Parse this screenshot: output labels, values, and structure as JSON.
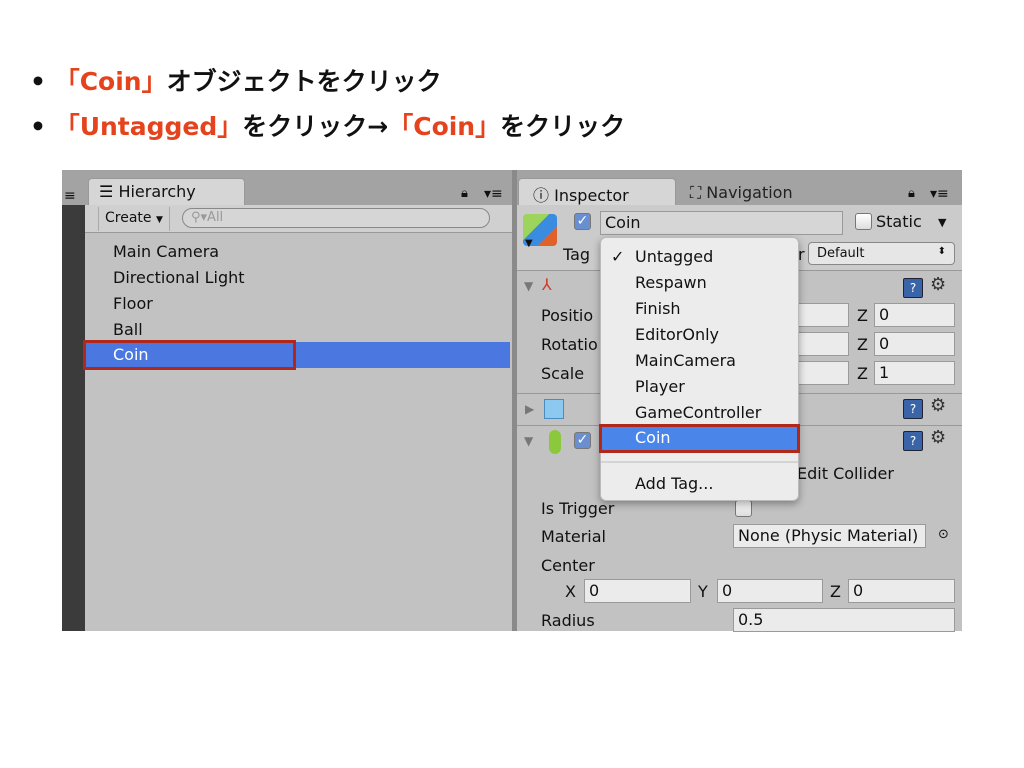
{
  "instructions": [
    {
      "bullet": "•",
      "parts": [
        {
          "text": "「Coin」",
          "red": true
        },
        {
          "text": "オブジェクトをクリック",
          "red": false
        }
      ]
    },
    {
      "bullet": "•",
      "parts": [
        {
          "text": "「Untagged」",
          "red": true
        },
        {
          "text": "をクリック→",
          "red": false
        },
        {
          "text": "「Coin」",
          "red": true
        },
        {
          "text": "をクリック",
          "red": false
        }
      ]
    }
  ],
  "colors": {
    "accent_red": "#e5431d",
    "selection_blue": "#4a78e0",
    "highlight_box": "#b0281c"
  },
  "hierarchy": {
    "tab_label": "Hierarchy",
    "create_label": "Create",
    "search_placeholder": "All",
    "items": [
      "Main Camera",
      "Directional Light",
      "Floor",
      "Ball",
      "Coin"
    ],
    "selected": "Coin"
  },
  "inspector": {
    "tab_label": "Inspector",
    "nav_tab_label": "Navigation",
    "object_name": "Coin",
    "static_label": "Static",
    "tag_label": "Tag",
    "layer_label_fragment": "r",
    "layer_value": "Default",
    "transform": {
      "rows": [
        {
          "label": "Positio",
          "z_label": "Z",
          "z": "0"
        },
        {
          "label": "Rotatio",
          "z_label": "Z",
          "z": "0"
        },
        {
          "label": "Scale",
          "z_label": "Z",
          "z": "1"
        }
      ]
    },
    "collider": {
      "edit_collider": "Edit Collider",
      "is_trigger_label": "Is Trigger",
      "material_label": "Material",
      "material_value": "None (Physic Material)",
      "center_label": "Center",
      "center": [
        {
          "axis": "X",
          "value": "0"
        },
        {
          "axis": "Y",
          "value": "0"
        },
        {
          "axis": "Z",
          "value": "0"
        }
      ],
      "radius_label": "Radius",
      "radius_value": "0.5"
    }
  },
  "tag_menu": {
    "checkmark": "✓",
    "items": [
      "Untagged",
      "Respawn",
      "Finish",
      "EditorOnly",
      "MainCamera",
      "Player",
      "GameController",
      "Coin"
    ],
    "checked": "Untagged",
    "highlighted": "Coin",
    "add_tag": "Add Tag..."
  }
}
